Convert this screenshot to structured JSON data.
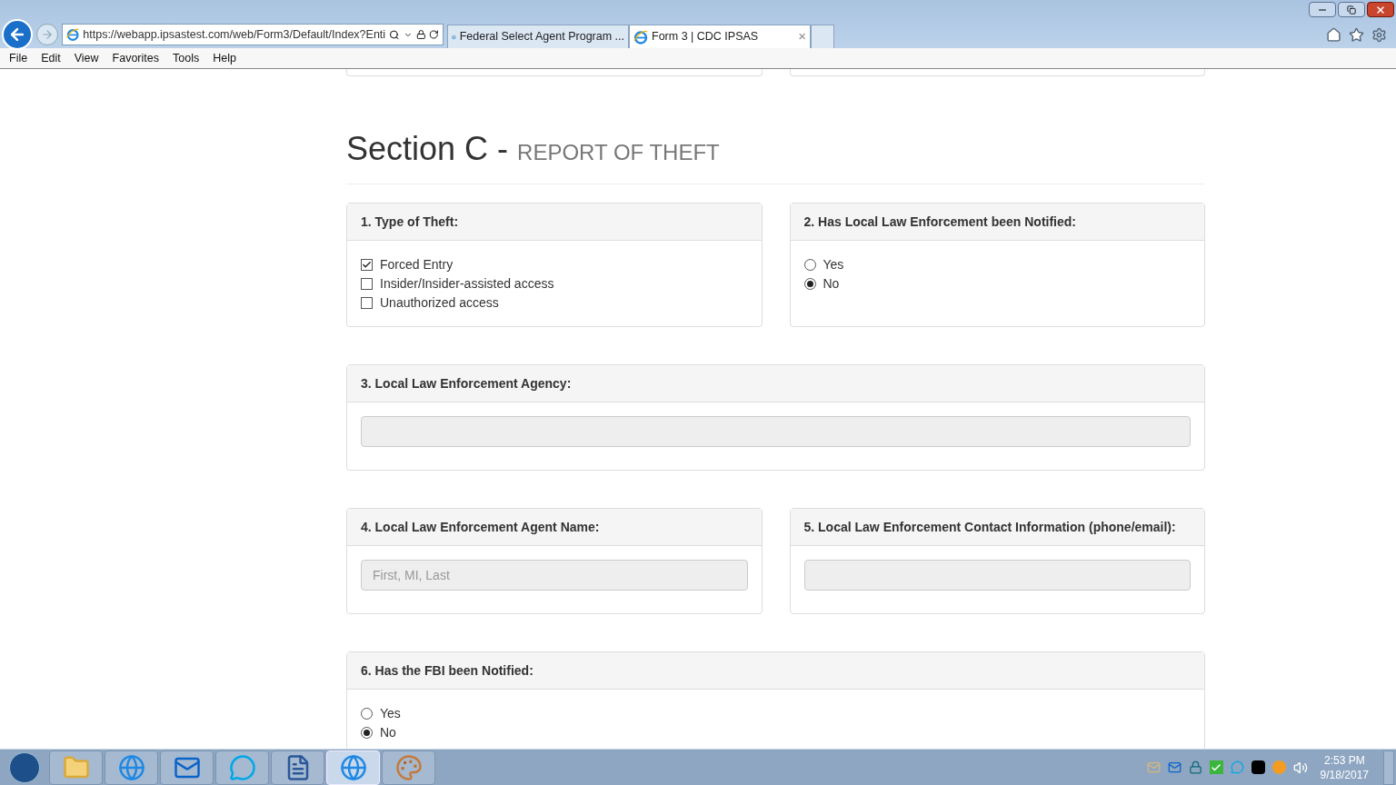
{
  "browser": {
    "address": "https://webapp.ipsastest.com/web/Form3/Default/Index?Enti",
    "tabs": [
      {
        "label": "Federal Select Agent Program ...",
        "selected": false,
        "closable": false
      },
      {
        "label": "Form 3 | CDC IPSAS",
        "selected": true,
        "closable": true
      }
    ],
    "close_glyph": "×",
    "menu": [
      "File",
      "Edit",
      "View",
      "Favorites",
      "Tools",
      "Help"
    ]
  },
  "section": {
    "title": "Section C -",
    "subtitle": "REPORT OF THEFT"
  },
  "rows": [
    [
      {
        "kind": "checkboxes",
        "label": "1. Type of Theft:",
        "options": [
          {
            "label": "Forced Entry",
            "checked": true
          },
          {
            "label": "Insider/Insider-assisted access",
            "checked": false
          },
          {
            "label": "Unauthorized access",
            "checked": false
          }
        ]
      },
      {
        "kind": "radios",
        "label": "2. Has Local Law Enforcement been Notified:",
        "options": [
          {
            "label": "Yes",
            "selected": false
          },
          {
            "label": "No",
            "selected": true
          }
        ]
      }
    ],
    [
      {
        "kind": "text",
        "label": "3. Local Law Enforcement Agency:",
        "disabled": true
      }
    ],
    [
      {
        "kind": "text",
        "label": "4. Local Law Enforcement Agent Name:",
        "placeholder": "First, MI, Last",
        "disabled": true
      },
      {
        "kind": "text",
        "label": "5. Local Law Enforcement Contact Information (phone/email):",
        "disabled": true
      }
    ],
    [
      {
        "kind": "radios",
        "label": "6. Has the FBI been Notified:",
        "options": [
          {
            "label": "Yes",
            "selected": false
          },
          {
            "label": "No",
            "selected": true
          }
        ]
      }
    ]
  ],
  "taskbar": {
    "apps": [
      {
        "kind": "folder",
        "selected": false
      },
      {
        "kind": "browser",
        "selected": false
      },
      {
        "kind": "mail",
        "selected": false
      },
      {
        "kind": "chat",
        "selected": false
      },
      {
        "kind": "document",
        "selected": false
      },
      {
        "kind": "browser",
        "selected": true
      },
      {
        "kind": "paint",
        "selected": false
      }
    ],
    "time": "2:53 PM",
    "date": "9/18/2017"
  }
}
